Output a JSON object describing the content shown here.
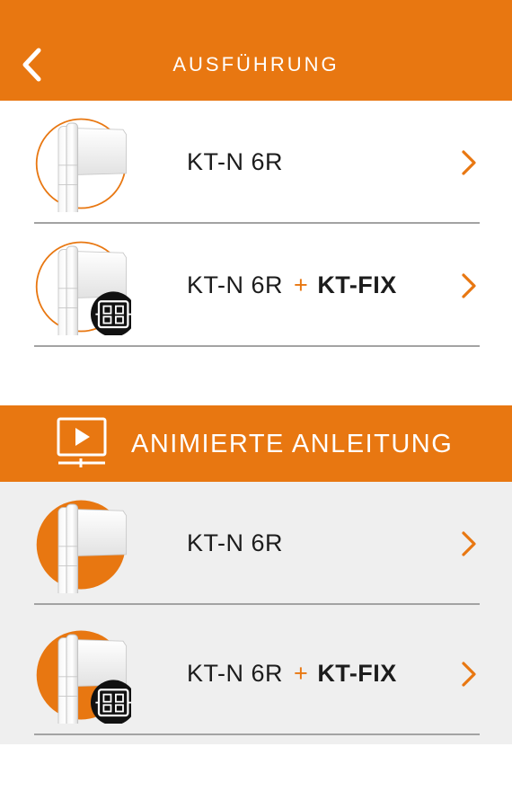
{
  "header": {
    "title": "AUSFÜHRUNG",
    "back_icon": "chevron-left-icon",
    "color": "#e87711"
  },
  "execution_items": [
    {
      "name": "KT-N 6R",
      "plus": "",
      "addon": "",
      "icon": "hinge-outline-icon"
    },
    {
      "name": "KT-N 6R",
      "plus": "+",
      "addon": "KT-FIX",
      "icon": "hinge-fix-outline-icon"
    }
  ],
  "animation_banner": {
    "label": "ANIMIERTE ANLEITUNG",
    "icon": "video-player-icon"
  },
  "animation_items": [
    {
      "name": "KT-N 6R",
      "plus": "",
      "addon": "",
      "icon": "hinge-filled-icon"
    },
    {
      "name": "KT-N 6R",
      "plus": "+",
      "addon": "KT-FIX",
      "icon": "hinge-fix-filled-icon"
    }
  ],
  "colors": {
    "accent": "#e87711",
    "divider": "#a3a3a3",
    "bottom_background": "#efefef"
  }
}
